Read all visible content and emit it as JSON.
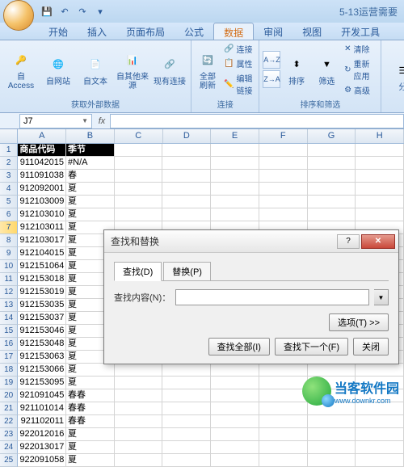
{
  "title_text": "5-13运营需要",
  "quick_access": {
    "save": "💾",
    "undo": "↶",
    "redo": "↷",
    "more": "▾"
  },
  "tabs": [
    "开始",
    "插入",
    "页面布局",
    "公式",
    "数据",
    "审阅",
    "视图",
    "开发工具"
  ],
  "active_tab_index": 4,
  "ribbon": {
    "group1": {
      "label": "获取外部数据",
      "buttons": [
        {
          "label": "自 Access"
        },
        {
          "label": "自网站"
        },
        {
          "label": "自文本"
        },
        {
          "label": "自其他来源"
        },
        {
          "label": "现有连接"
        }
      ]
    },
    "group2": {
      "label": "连接",
      "main": "全部刷新",
      "small": [
        "连接",
        "属性",
        "编辑链接"
      ]
    },
    "group3": {
      "label": "排序和筛选",
      "sort_asc": "A→Z",
      "sort_desc": "Z→A",
      "sort_btn": "排序",
      "filter_btn": "筛选",
      "small": [
        "清除",
        "重新应用",
        "高级"
      ]
    },
    "group4": {
      "main": "分"
    }
  },
  "name_box": "J7",
  "fx_label": "fx",
  "columns": [
    "A",
    "B",
    "C",
    "D",
    "E",
    "F",
    "G",
    "H"
  ],
  "header_row": {
    "A": "商品代码",
    "B": "季节"
  },
  "selected_row": 7,
  "rows": [
    {
      "n": 2,
      "A": "911042015",
      "B": "#N/A"
    },
    {
      "n": 3,
      "A": "911091038",
      "B": "春"
    },
    {
      "n": 4,
      "A": "912092001",
      "B": "夏"
    },
    {
      "n": 5,
      "A": "912103009",
      "B": "夏"
    },
    {
      "n": 6,
      "A": "912103010",
      "B": "夏"
    },
    {
      "n": 7,
      "A": "912103011",
      "B": "夏"
    },
    {
      "n": 8,
      "A": "912103017",
      "B": "夏"
    },
    {
      "n": 9,
      "A": "912104015",
      "B": "夏"
    },
    {
      "n": 10,
      "A": "912151064",
      "B": "夏"
    },
    {
      "n": 11,
      "A": "912153018",
      "B": "夏"
    },
    {
      "n": 12,
      "A": "912153019",
      "B": "夏"
    },
    {
      "n": 13,
      "A": "912153035",
      "B": "夏"
    },
    {
      "n": 14,
      "A": "912153037",
      "B": "夏"
    },
    {
      "n": 15,
      "A": "912153046",
      "B": "夏"
    },
    {
      "n": 16,
      "A": "912153048",
      "B": "夏"
    },
    {
      "n": 17,
      "A": "912153063",
      "B": "夏"
    },
    {
      "n": 18,
      "A": "912153066",
      "B": "夏"
    },
    {
      "n": 19,
      "A": "912153095",
      "B": "夏"
    },
    {
      "n": 20,
      "A": "921091045",
      "B": "春春"
    },
    {
      "n": 21,
      "A": "921101014",
      "B": "春春"
    },
    {
      "n": 22,
      "A": "921102011",
      "B": "春春"
    },
    {
      "n": 23,
      "A": "922012016",
      "B": "夏"
    },
    {
      "n": 24,
      "A": "922013017",
      "B": "夏"
    },
    {
      "n": 25,
      "A": "922091058",
      "B": "夏"
    }
  ],
  "dialog": {
    "title": "查找和替换",
    "help": "?",
    "close": "✕",
    "tabs": {
      "find": "查找(D)",
      "replace": "替换(P)"
    },
    "find_label": "查找内容(N)：",
    "options_btn": "选项(T) >>",
    "find_all": "查找全部(I)",
    "find_next": "查找下一个(F)",
    "close_btn": "关闭"
  },
  "watermark": {
    "main": "当客软件园",
    "sub": "www.downkr.com"
  }
}
